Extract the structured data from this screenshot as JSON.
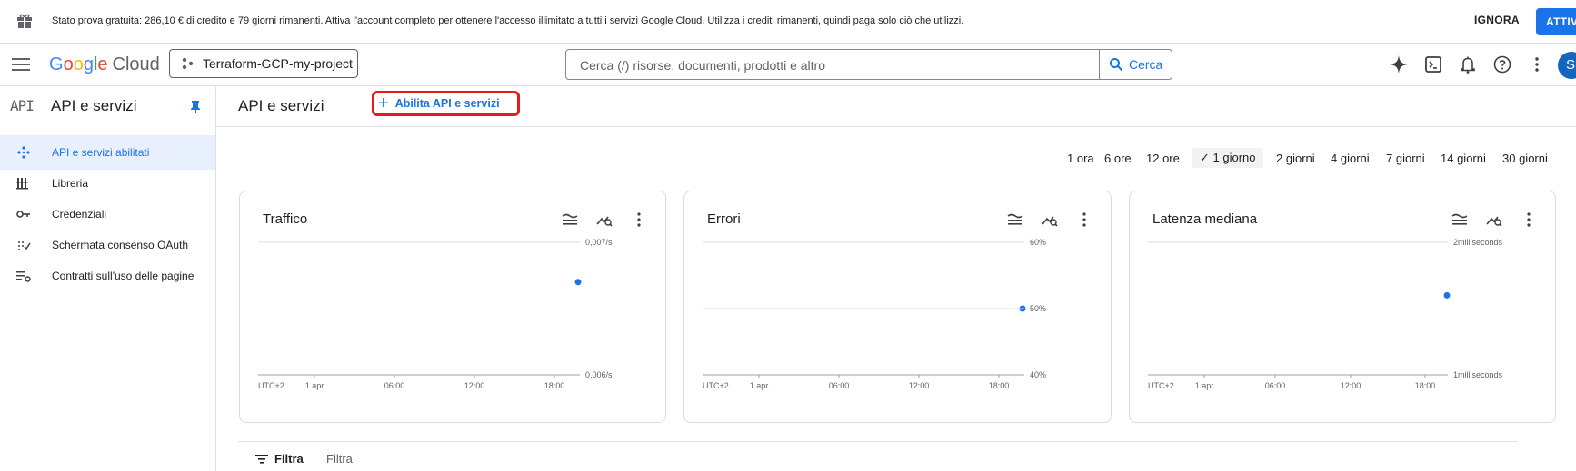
{
  "banner": {
    "message": "Stato prova gratuita: 286,10 € di credito e 79 giorni rimanenti. Attiva l'account completo per ottenere l'accesso illimitato a tutti i servizi Google Cloud. Utilizza i crediti rimanenti, quindi paga solo ciò che utilizzi.",
    "dismiss_label": "IGNORA",
    "activate_label": "ATTIV"
  },
  "topbar": {
    "logo_google": [
      "G",
      "o",
      "o",
      "g",
      "l",
      "e"
    ],
    "logo_cloud": "Cloud",
    "project_name": "Terraform-GCP-my-project",
    "search_placeholder": "Cerca (/) risorse, documenti, prodotti e altro",
    "search_button": "Cerca",
    "avatar_letter": "S"
  },
  "sidebar": {
    "api_glyph": "API",
    "title": "API e servizi",
    "items": [
      {
        "label": "API e servizi abilitati",
        "icon": "api-hub-icon",
        "active": true
      },
      {
        "label": "Libreria",
        "icon": "library-icon",
        "active": false
      },
      {
        "label": "Credenziali",
        "icon": "key-icon",
        "active": false
      },
      {
        "label": "Schermata consenso OAuth",
        "icon": "consent-icon",
        "active": false
      },
      {
        "label": "Contratti sull'uso delle pagine",
        "icon": "page-usage-icon",
        "active": false
      }
    ]
  },
  "main": {
    "title": "API e servizi",
    "enable_button": "Abilita API e servizi",
    "time_ranges": [
      "1 ora",
      "6 ore",
      "12 ore",
      "1 giorno",
      "2 giorni",
      "4 giorni",
      "7 giorni",
      "14 giorni",
      "30 giorni"
    ],
    "selected_range": "1 giorno",
    "filter_label": "Filtra",
    "filter_placeholder": "Filtra"
  },
  "colors": {
    "accent": "#1a73e8",
    "highlight_border": "#e61b1b",
    "active_bg": "#e8f0fe"
  },
  "chart_data": [
    {
      "type": "scatter",
      "title": "Traffico",
      "x_ticks": [
        "UTC+2",
        "1 apr",
        "06:00",
        "12:00",
        "18:00"
      ],
      "y_ticks": [
        "0,007/s",
        "0,006/s"
      ],
      "points": [
        {
          "x": "~18:20",
          "y": 0.0067
        }
      ]
    },
    {
      "type": "scatter",
      "title": "Errori",
      "x_ticks": [
        "UTC+2",
        "1 apr",
        "06:00",
        "12:00",
        "18:00"
      ],
      "y_ticks": [
        "60%",
        "50%",
        "40%"
      ],
      "points": [
        {
          "x": "~18:20",
          "y": 50
        }
      ]
    },
    {
      "type": "scatter",
      "title": "Latenza mediana",
      "x_ticks": [
        "UTC+2",
        "1 apr",
        "06:00",
        "12:00",
        "18:00"
      ],
      "y_ticks": [
        "2milliseconds",
        "1milliseconds"
      ],
      "points": [
        {
          "x": "~18:20",
          "y": 1.6
        }
      ]
    }
  ]
}
